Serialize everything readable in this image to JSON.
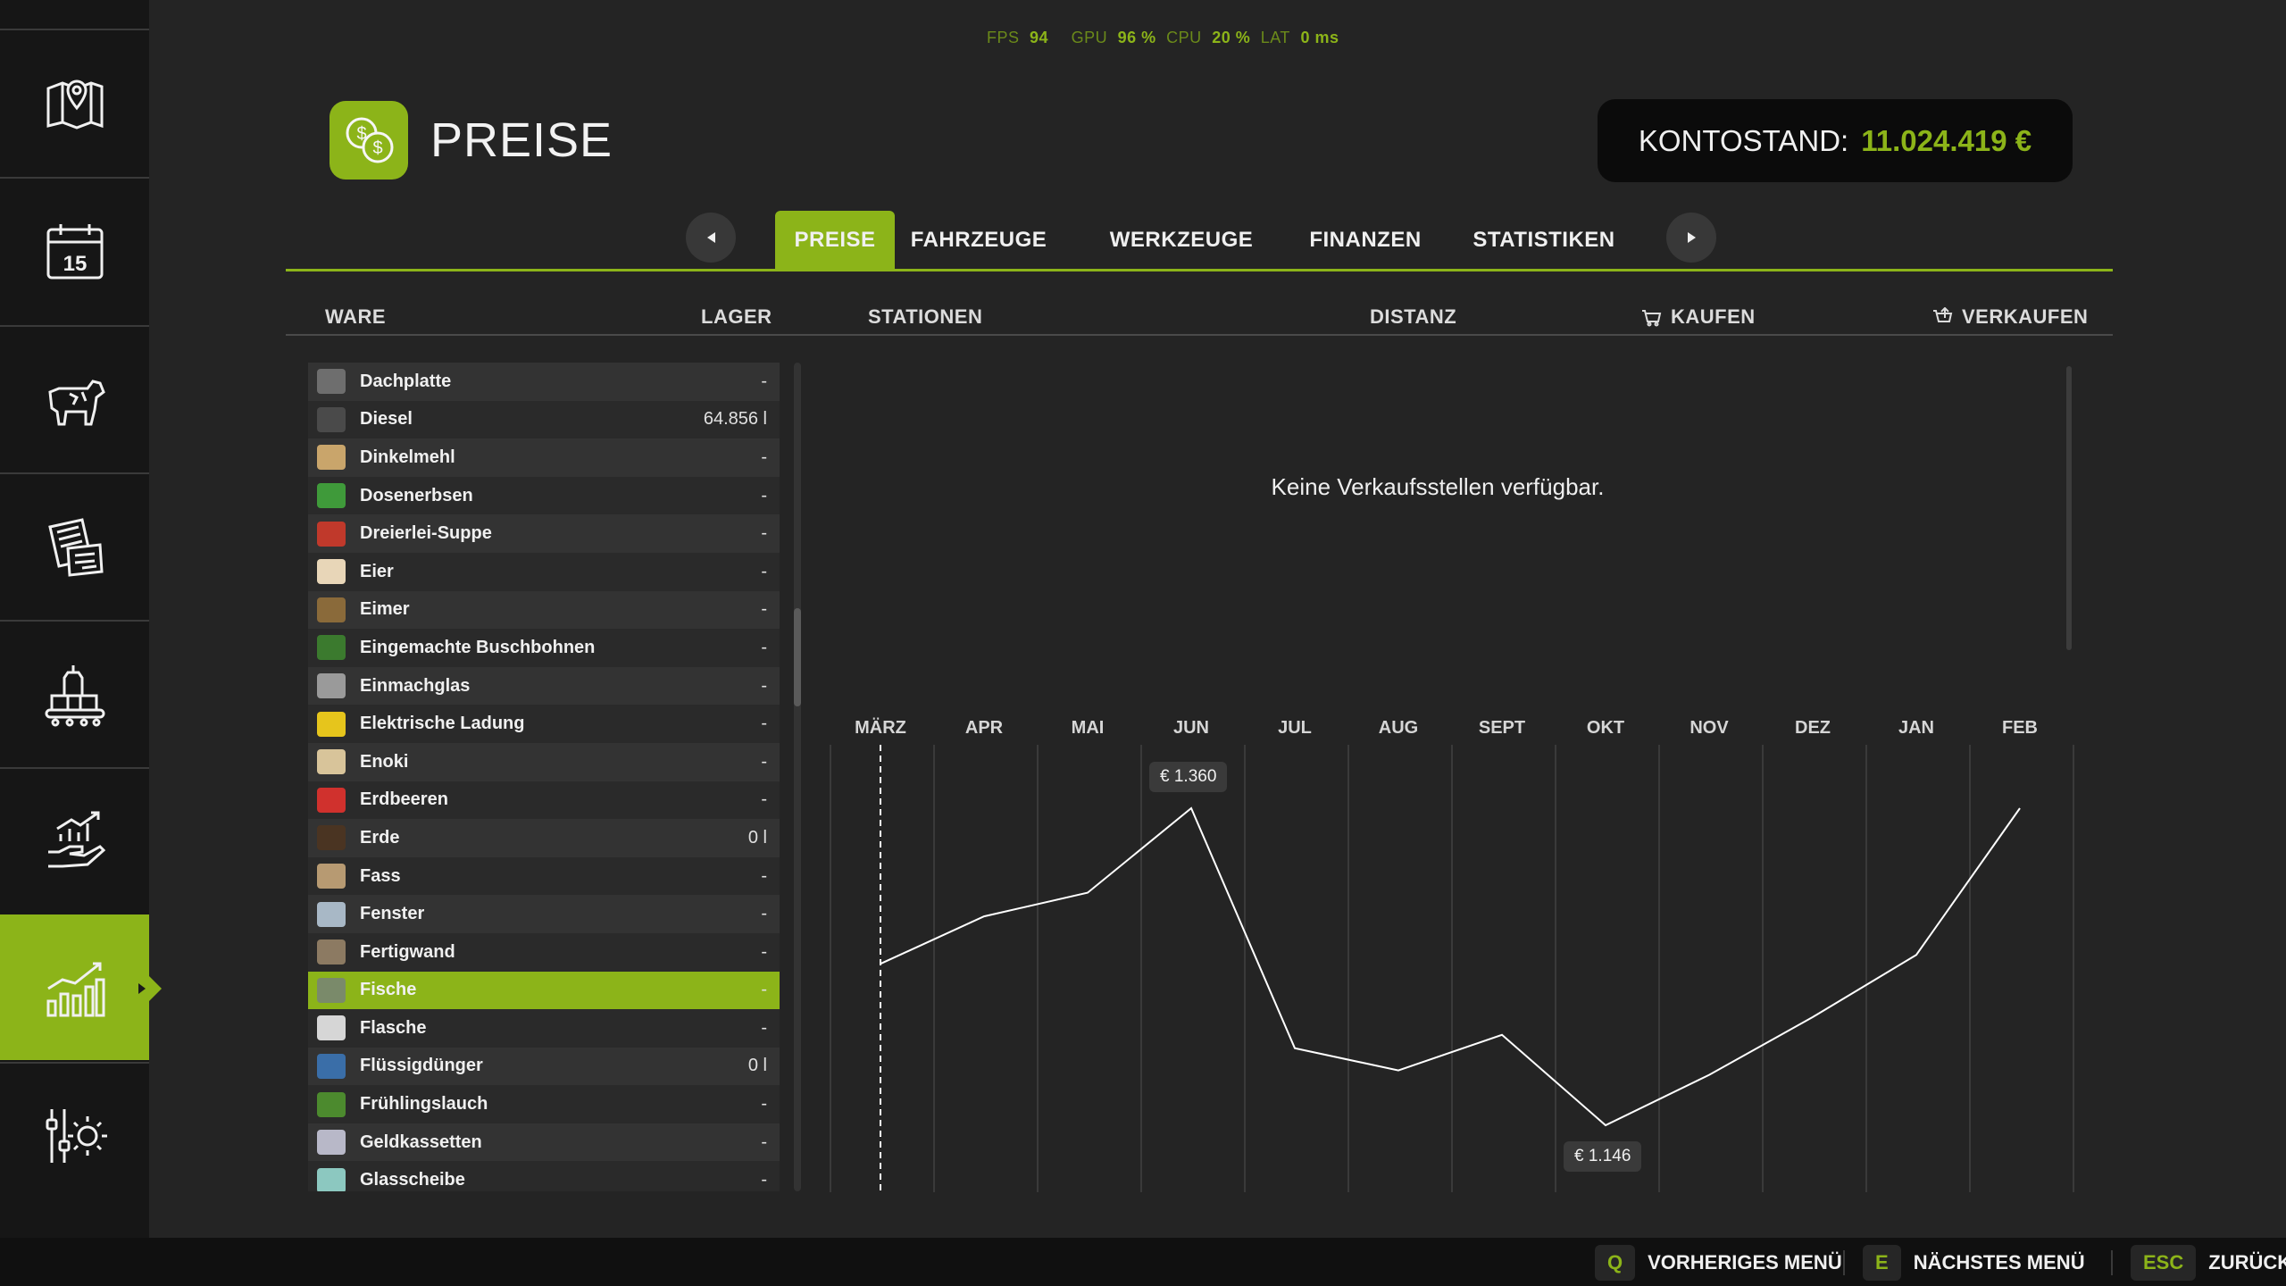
{
  "perf": {
    "fps_label": "FPS",
    "fps": "94",
    "gpu_label": "GPU",
    "gpu": "96 %",
    "cpu_label": "CPU",
    "cpu": "20 %",
    "lat_label": "LAT",
    "lat": "0 ms"
  },
  "header": {
    "title": "PREISE",
    "balance_label": "KONTOSTAND:",
    "balance_value": "11.024.419 €"
  },
  "sidebar": {
    "items": [
      {
        "icon": "map-icon"
      },
      {
        "icon": "calendar-icon",
        "day": "15"
      },
      {
        "icon": "cow-icon"
      },
      {
        "icon": "contracts-icon"
      },
      {
        "icon": "production-icon"
      },
      {
        "icon": "finance-hand-icon"
      },
      {
        "icon": "bar-chart-icon",
        "active": true
      },
      {
        "icon": "settings-sliders-icon"
      }
    ]
  },
  "tabs": [
    "PREISE",
    "FAHRZEUGE",
    "WERKZEUGE",
    "FINANZEN",
    "STATISTIKEN"
  ],
  "columns": {
    "ware": "WARE",
    "lager": "LAGER",
    "stationen": "STATIONEN",
    "distanz": "DISTANZ",
    "kaufen": "KAUFEN",
    "verkaufen": "VERKAUFEN"
  },
  "products": [
    {
      "name": "Dachplatte",
      "qty": "-",
      "color": "#6e6e6e"
    },
    {
      "name": "Diesel",
      "qty": "64.856 l",
      "color": "#4a4a4a"
    },
    {
      "name": "Dinkelmehl",
      "qty": "-",
      "color": "#c9a56b"
    },
    {
      "name": "Dosenerbsen",
      "qty": "-",
      "color": "#3f9a3a"
    },
    {
      "name": "Dreierlei-Suppe",
      "qty": "-",
      "color": "#c0392b"
    },
    {
      "name": "Eier",
      "qty": "-",
      "color": "#e8d6b8"
    },
    {
      "name": "Eimer",
      "qty": "-",
      "color": "#8a6a3a"
    },
    {
      "name": "Eingemachte Buschbohnen",
      "qty": "-",
      "color": "#3b7a2e"
    },
    {
      "name": "Einmachglas",
      "qty": "-",
      "color": "#9a9a9a"
    },
    {
      "name": "Elektrische Ladung",
      "qty": "-",
      "color": "#e6c51c"
    },
    {
      "name": "Enoki",
      "qty": "-",
      "color": "#d8c49a"
    },
    {
      "name": "Erdbeeren",
      "qty": "-",
      "color": "#d0312d"
    },
    {
      "name": "Erde",
      "qty": "0 l",
      "color": "#4a3422"
    },
    {
      "name": "Fass",
      "qty": "-",
      "color": "#b79a72"
    },
    {
      "name": "Fenster",
      "qty": "-",
      "color": "#a8b8c6"
    },
    {
      "name": "Fertigwand",
      "qty": "-",
      "color": "#8c7a62"
    },
    {
      "name": "Fische",
      "qty": "-",
      "color": "#7a8a6a",
      "selected": true
    },
    {
      "name": "Flasche",
      "qty": "-",
      "color": "#d6d6d6"
    },
    {
      "name": "Flüssigdünger",
      "qty": "0 l",
      "color": "#3a6ea8"
    },
    {
      "name": "Frühlingslauch",
      "qty": "-",
      "color": "#4c8a2e"
    },
    {
      "name": "Geldkassetten",
      "qty": "-",
      "color": "#b8b8c8"
    },
    {
      "name": "Glasscheibe",
      "qty": "-",
      "color": "#8cc8c0"
    }
  ],
  "stations": {
    "empty_message": "Keine Verkaufsstellen verfügbar."
  },
  "chart_data": {
    "type": "line",
    "categories": [
      "MÄRZ",
      "APR",
      "MAI",
      "JUN",
      "JUL",
      "AUG",
      "SEPT",
      "OKT",
      "NOV",
      "DEZ",
      "JAN",
      "FEB"
    ],
    "values": [
      1255,
      1287,
      1303,
      1360,
      1198,
      1183,
      1207,
      1146,
      1180,
      1219,
      1261,
      1360
    ],
    "current_month": "MÄRZ",
    "annotations": [
      {
        "category": "JUN",
        "label": "€ 1.360"
      },
      {
        "category": "OKT",
        "label": "€ 1.146"
      }
    ],
    "grid": true
  },
  "footer": {
    "hints": [
      {
        "key": "Q",
        "label": "VORHERIGES MENÜ"
      },
      {
        "key": "E",
        "label": "NÄCHSTES MENÜ"
      },
      {
        "key": "ESC",
        "label": "ZURÜCK"
      }
    ]
  }
}
